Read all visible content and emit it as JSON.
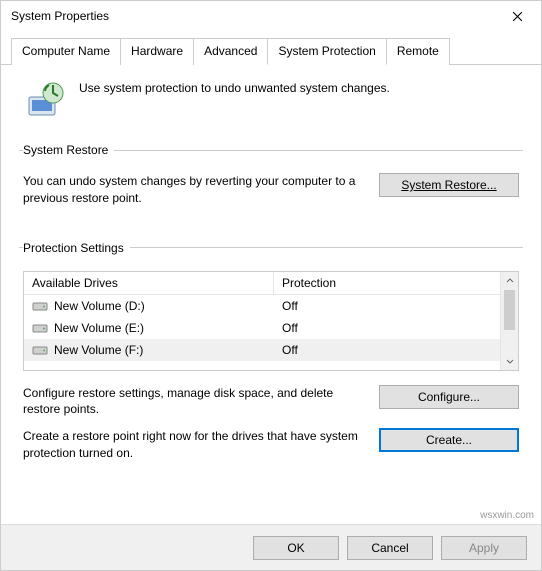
{
  "window": {
    "title": "System Properties"
  },
  "tabs": {
    "computer_name": "Computer Name",
    "hardware": "Hardware",
    "advanced": "Advanced",
    "system_protection": "System Protection",
    "remote": "Remote"
  },
  "intro": "Use system protection to undo unwanted system changes.",
  "system_restore": {
    "legend": "System Restore",
    "desc": "You can undo system changes by reverting your computer to a previous restore point.",
    "btn": "System Restore..."
  },
  "protection_settings": {
    "legend": "Protection Settings",
    "col_drives": "Available Drives",
    "col_protection": "Protection",
    "rows": [
      {
        "name": "New Volume (D:)",
        "prot": "Off"
      },
      {
        "name": "New Volume (E:)",
        "prot": "Off"
      },
      {
        "name": "New Volume (F:)",
        "prot": "Off"
      }
    ],
    "configure_desc": "Configure restore settings, manage disk space, and delete restore points.",
    "configure_btn": "Configure...",
    "create_desc": "Create a restore point right now for the drives that have system protection turned on.",
    "create_btn": "Create..."
  },
  "buttons": {
    "ok": "OK",
    "cancel": "Cancel",
    "apply": "Apply"
  },
  "watermark": "wsxwin.com"
}
